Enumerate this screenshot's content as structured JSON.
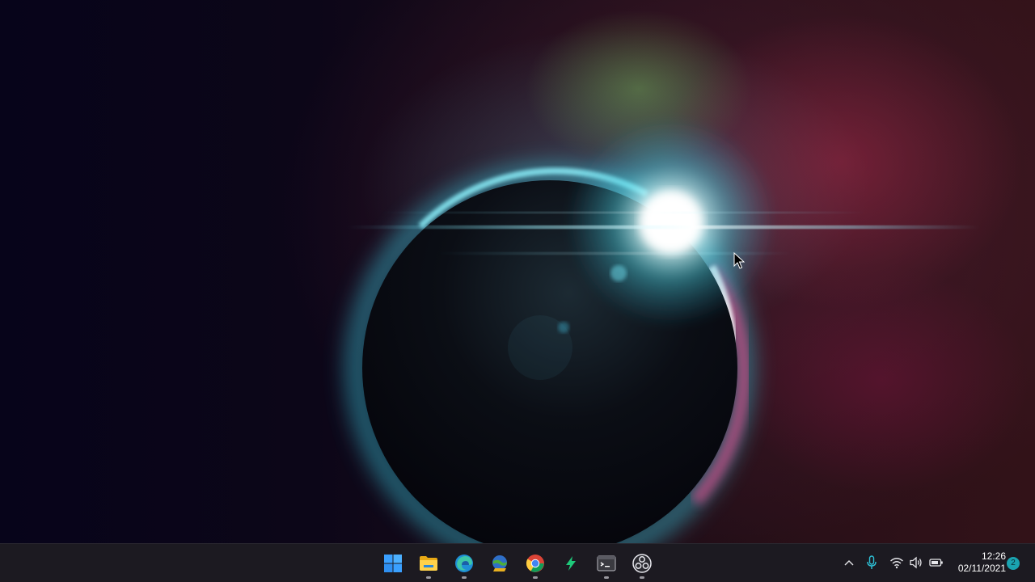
{
  "desktop": {
    "wallpaper": "solar-eclipse-wallpaper",
    "pointer": "arrow-cursor"
  },
  "taskbar": {
    "apps": [
      {
        "name": "start-button",
        "icon": "windows-logo-icon",
        "running": false
      },
      {
        "name": "file-explorer",
        "icon": "folder-icon",
        "running": true
      },
      {
        "name": "microsoft-edge",
        "icon": "edge-icon",
        "running": true
      },
      {
        "name": "internet-download-manager",
        "icon": "idm-globe-icon",
        "running": false
      },
      {
        "name": "google-chrome",
        "icon": "chrome-icon",
        "running": true
      },
      {
        "name": "lightning-app",
        "icon": "lightning-icon",
        "running": false
      },
      {
        "name": "terminal",
        "icon": "terminal-icon",
        "running": true
      },
      {
        "name": "obs-studio",
        "icon": "obs-icon",
        "running": true
      }
    ],
    "tray": {
      "icons": [
        "chevron-up-icon",
        "microphone-icon",
        "wifi-icon",
        "speaker-icon",
        "battery-icon"
      ],
      "time": "12:26",
      "date": "02/11/2021",
      "notification_count": "2"
    }
  },
  "colors": {
    "taskbar": "#1c1a21",
    "accent": "#1aa3b0",
    "windows_blue": "#3aa0ff"
  }
}
